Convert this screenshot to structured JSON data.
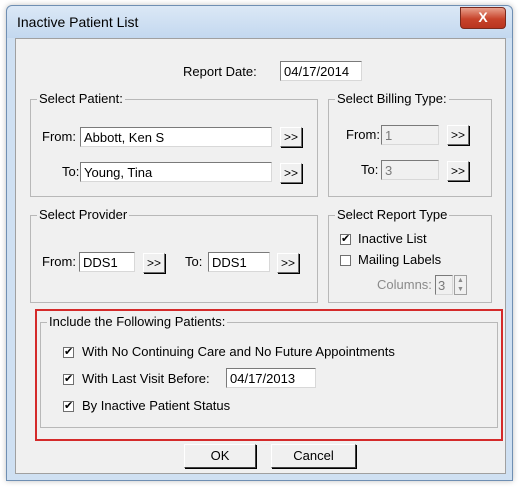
{
  "window": {
    "title": "Inactive Patient List",
    "close_label": "X"
  },
  "report_date": {
    "label": "Report Date:",
    "value": "04/17/2014"
  },
  "select_patient": {
    "caption": "Select Patient:",
    "from_label": "From:",
    "from_value": "Abbott, Ken S",
    "to_label": "To:",
    "to_value": "Young, Tina",
    "browse_label": ">>"
  },
  "select_billing_type": {
    "caption": "Select Billing Type:",
    "from_label": "From:",
    "from_value": "1",
    "to_label": "To:",
    "to_value": "3",
    "browse_label": ">>"
  },
  "select_provider": {
    "caption": "Select Provider",
    "from_label": "From:",
    "from_value": "DDS1",
    "to_label": "To:",
    "to_value": "DDS1",
    "browse_label": ">>"
  },
  "select_report_type": {
    "caption": "Select Report Type",
    "inactive_list": {
      "label": "Inactive List",
      "checked": true
    },
    "mailing_labels": {
      "label": "Mailing Labels",
      "checked": false
    },
    "columns_label": "Columns:",
    "columns_value": "3"
  },
  "include": {
    "caption": "Include the Following Patients:",
    "no_continuing_care": {
      "label": "With No Continuing Care and No Future Appointments",
      "checked": true
    },
    "last_visit_before": {
      "label": "With Last Visit Before:",
      "checked": true,
      "date": "04/17/2013"
    },
    "inactive_status": {
      "label": "By Inactive Patient Status",
      "checked": true
    }
  },
  "buttons": {
    "ok": "OK",
    "cancel": "Cancel"
  },
  "colors": {
    "highlight": "#d42a2a",
    "close_button": "#c7432b",
    "title_bar": "#cfe0f2"
  }
}
